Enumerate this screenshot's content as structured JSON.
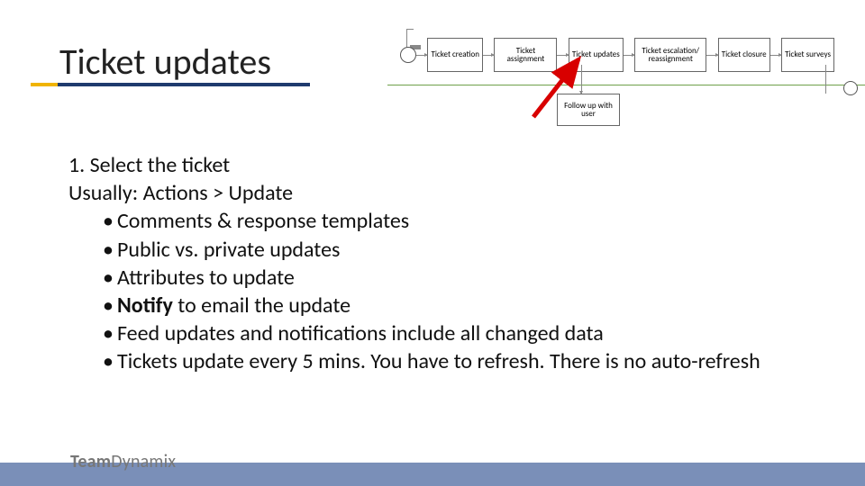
{
  "title": "Ticket updates",
  "flow": {
    "n1": "Ticket creation",
    "n2": "Ticket assignment",
    "n3": "Ticket updates",
    "n4": "Ticket escalation/ reassignment",
    "n5": "Ticket closure",
    "n6": "Ticket surveys",
    "followup": "Follow up with user"
  },
  "body": {
    "line1": "1. Select the ticket",
    "line2": "Usually: Actions > Update",
    "bullets": [
      {
        "pre": "Comments & response templates"
      },
      {
        "pre": "Public vs. private updates"
      },
      {
        "pre": "Attributes to update"
      },
      {
        "bold": "Notify",
        "post": " to email the update"
      },
      {
        "pre": "Feed updates and notifications include all changed data"
      },
      {
        "pre": "Tickets update every 5 mins.  You have to refresh.  There is no auto-refresh"
      }
    ]
  },
  "footer": {
    "brand_bold": "Team",
    "brand_light": "Dynamix"
  }
}
